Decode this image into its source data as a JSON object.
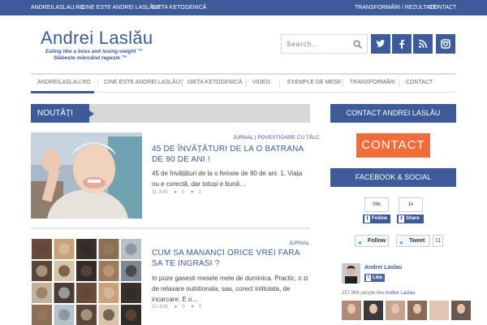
{
  "topbar": {
    "left": [
      "ANDREILASLAU.RO",
      "CINE ESTE ANDREI LASLĂU?",
      "DIETA KETOGENICĂ"
    ],
    "right": [
      "TRANSFORMĂRI / REZULTATE",
      "CONTACT"
    ]
  },
  "logo": {
    "title": "Andrei Laslău",
    "tagline1": "Eating like a boss and losing weight ™",
    "tagline2": "Slăbește mâncând regește ™"
  },
  "search": {
    "placeholder": "Search..."
  },
  "social": [
    {
      "icon": "twitter-icon",
      "glyph": "t"
    },
    {
      "icon": "facebook-icon",
      "glyph": "f"
    },
    {
      "icon": "rss-icon",
      "glyph": "rss"
    },
    {
      "icon": "instagram-icon",
      "glyph": "ig"
    }
  ],
  "nav": [
    "ANDREILASLAU.RO",
    "CINE ESTE ANDREI LASLĂU?",
    "DIETA KETOGENICĂ",
    "VIDEO",
    "EXEMPLE DE MESE",
    "TRANSFORMĂRI",
    "CONTACT"
  ],
  "section": {
    "title": "NOUTĂȚI"
  },
  "articles": [
    {
      "cat1": "JURNAL",
      "cat_sep": "|",
      "cat2": "POVESTIOARE CU TÂLC",
      "title": "45 DE ÎNVĂȚĂTURI DE LA O BATRANA DE 90 DE ANI !",
      "excerpt": "45 de învățături de la o femeie de 90 de ani. 1. Viața nu e corectă, dar totuși e bună…",
      "date": "11 JUN",
      "comments": "0",
      "likes": "2"
    },
    {
      "cat1": "JURNAL",
      "title": "CUM SA MANANCI ORICE VREI FARA SA TE INGRASI ?",
      "excerpt": "In poze gasesti mesele mele de duminica. Practic, o zi de relaxare nutritionala, sau, corect intitulata, de incarcare. E o…",
      "date": "10 JUN",
      "comments": "0",
      "likes": "0"
    }
  ],
  "sidebar": {
    "contact_head": "CONTACT ANDREI LASLĂU",
    "contact_button": "CONTACT",
    "social_head": "FACEBOOK & SOCIAL",
    "fb_follow_count": "36k",
    "fb_follow_label": "Follow",
    "fb_share_count": "1k",
    "fb_share_label": "Share",
    "tw_follow": "Follow",
    "tw_tweet": "Tweet",
    "tw_count": "11",
    "fb_page_name": "Andrei Laslau",
    "fb_like": "Like",
    "fb_people": "257,968 people like",
    "fb_people_link": "Andrei Laslau."
  },
  "colors": {
    "brand": "#3d5a99",
    "accent": "#f26b3a"
  }
}
